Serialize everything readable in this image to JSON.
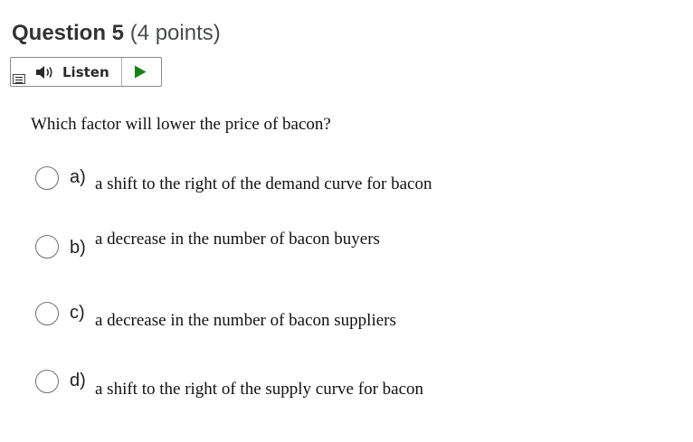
{
  "question": {
    "title": "Question 5",
    "points": " (4 points)",
    "text": "Which factor will lower the price of bacon?"
  },
  "toolbar": {
    "listen_label": "Listen",
    "icons": [
      "menu-icon",
      "speaker-icon",
      "play-icon"
    ]
  },
  "options": [
    {
      "letter": "a)",
      "text": "a shift to the right of the demand curve for bacon",
      "selected": false
    },
    {
      "letter": "b)",
      "text": "a decrease in the number of bacon buyers",
      "selected": false
    },
    {
      "letter": "c)",
      "text": "a decrease in the number of bacon suppliers",
      "selected": false
    },
    {
      "letter": "d)",
      "text": "a shift to the right of the supply curve for bacon",
      "selected": false
    }
  ],
  "colors": {
    "play_green": "#1a7d1a",
    "radio_border": "#6e7376",
    "heading": "#333333"
  }
}
